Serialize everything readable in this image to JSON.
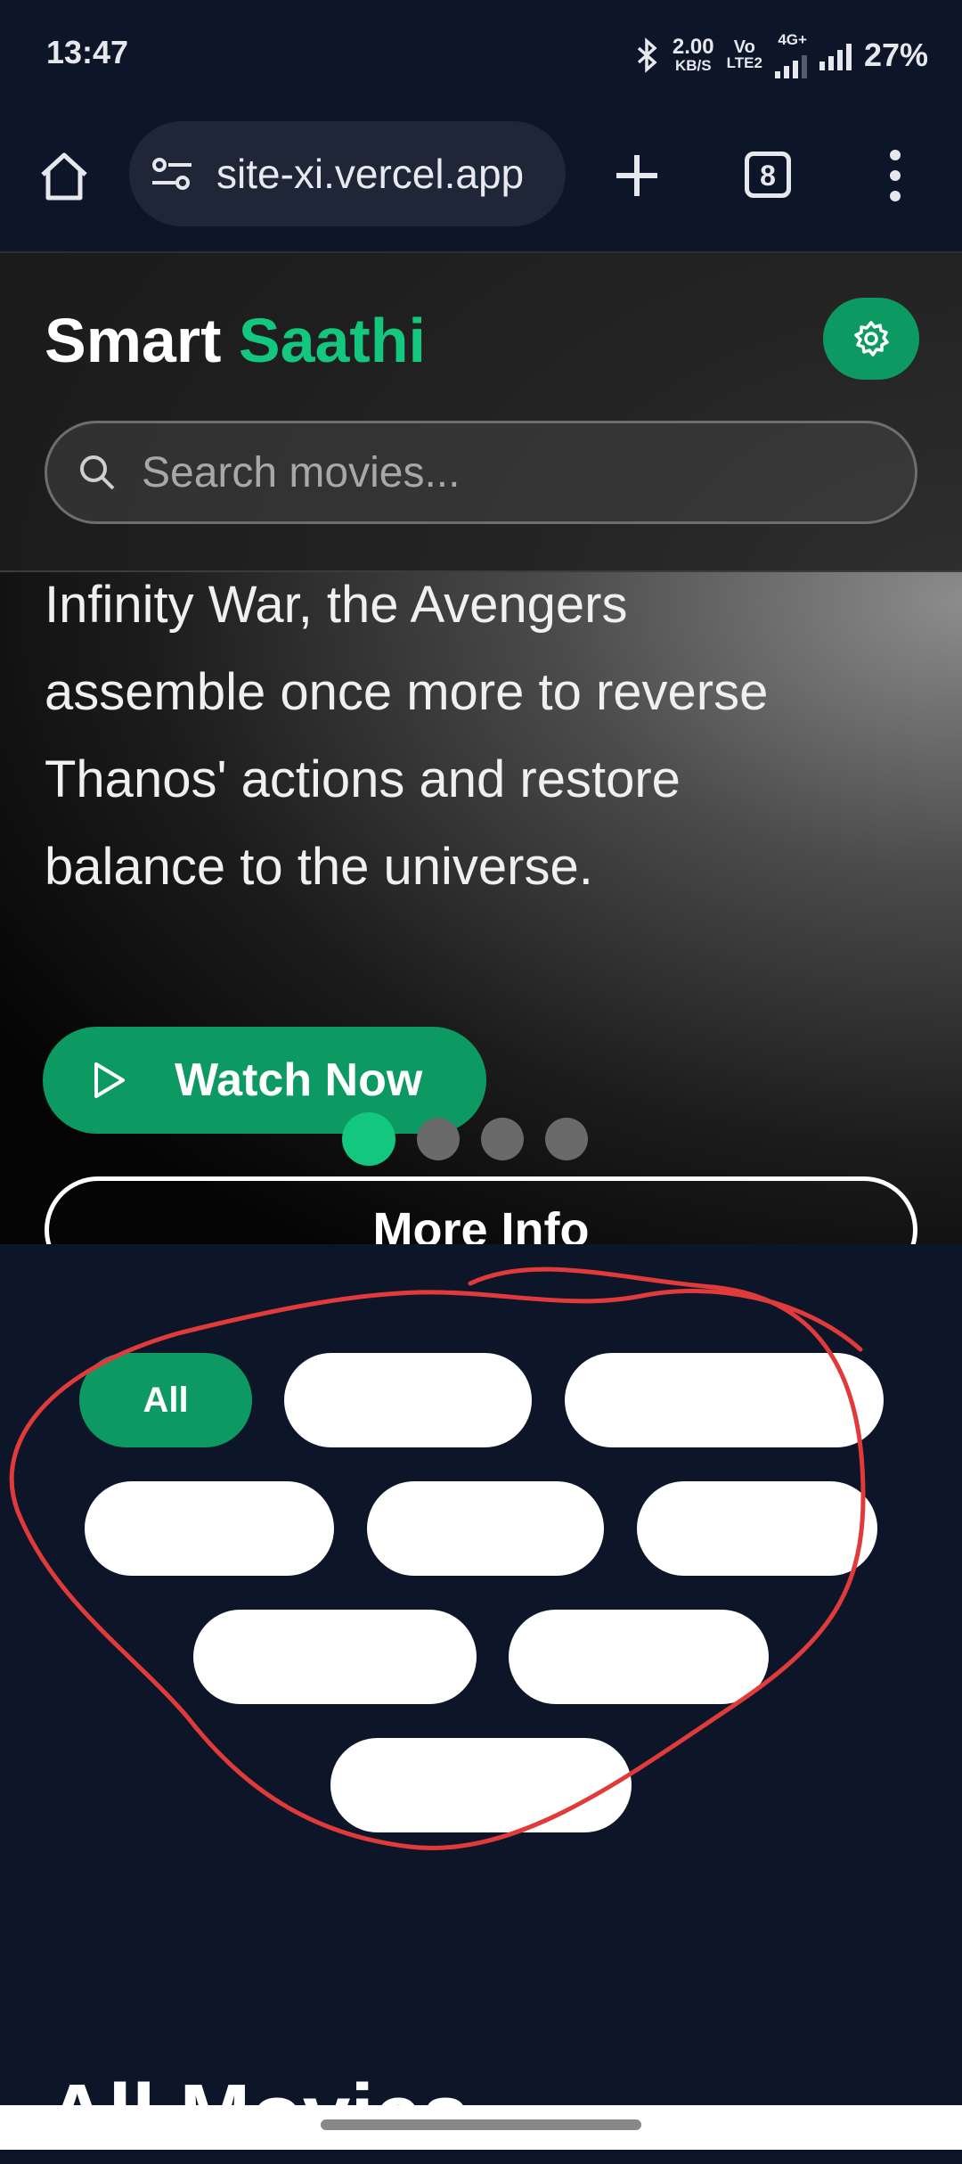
{
  "status_bar": {
    "time": "13:47",
    "net_speed_value": "2.00",
    "net_speed_unit": "KB/S",
    "volte_top": "Vo",
    "volte_bottom": "LTE2",
    "network": "4G+",
    "battery": "27%"
  },
  "browser": {
    "url": "site-xi.vercel.app",
    "tab_count": "8"
  },
  "app": {
    "brand_primary": "Smart",
    "brand_accent": "Saathi",
    "accent_color": "#14c77f",
    "search_placeholder": "Search movies..."
  },
  "hero": {
    "description": "Infinity War, the Avengers assemble once more to reverse Thanos' actions and restore balance to the universe.",
    "watch_label": "Watch Now",
    "more_label": "More Info",
    "carousel_total": 4,
    "carousel_active": 1
  },
  "filters": {
    "chips": [
      {
        "label": "All",
        "active": true
      },
      {
        "label": "",
        "active": false
      },
      {
        "label": "",
        "active": false
      },
      {
        "label": "",
        "active": false
      },
      {
        "label": "",
        "active": false
      },
      {
        "label": "",
        "active": false
      },
      {
        "label": "",
        "active": false
      },
      {
        "label": "",
        "active": false
      },
      {
        "label": "",
        "active": false
      }
    ]
  },
  "section": {
    "title": "All Movies"
  }
}
